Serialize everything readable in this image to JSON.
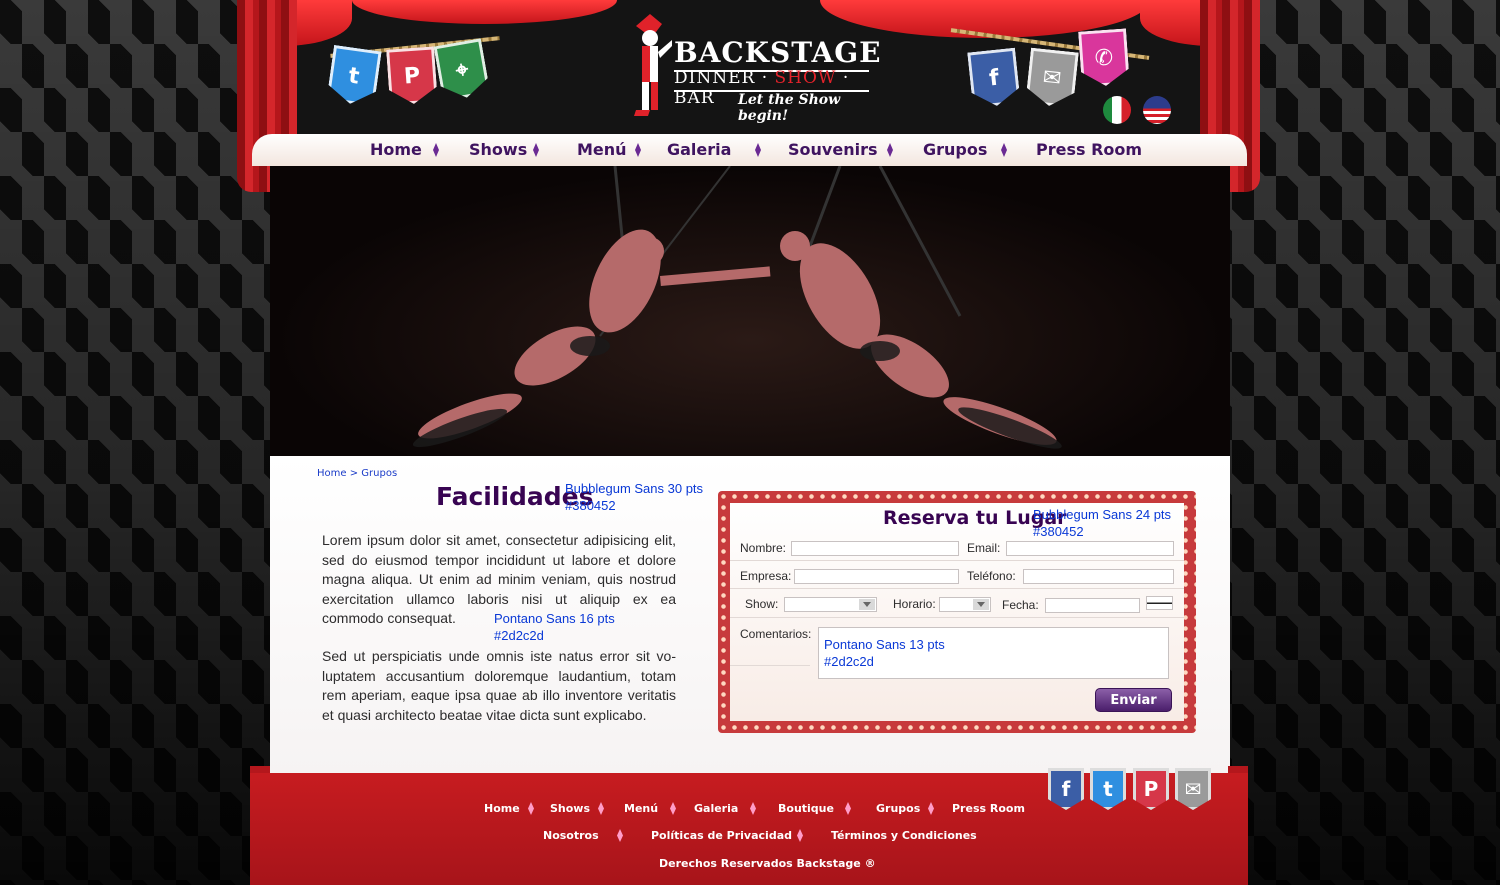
{
  "brand": {
    "title": "BACKSTAGE",
    "sub_left": "DINNER",
    "sub_mid": "SHOW",
    "sub_right": "BAR",
    "tagline": "Let the Show begin!"
  },
  "social_top_left": [
    {
      "icon": "twitter-icon",
      "glyph": "t",
      "color": "#2f8fe0"
    },
    {
      "icon": "pinterest-icon",
      "glyph": "P",
      "color": "#d63749"
    },
    {
      "icon": "location-icon",
      "glyph": "⌖",
      "color": "#2e8f4a"
    }
  ],
  "social_top_right": [
    {
      "icon": "facebook-icon",
      "glyph": "f",
      "color": "#3b5ea6"
    },
    {
      "icon": "email-icon",
      "glyph": "✉",
      "color": "#9a9a9a"
    },
    {
      "icon": "phone-icon",
      "glyph": "✆",
      "color": "#d9369c"
    }
  ],
  "nav": {
    "items": [
      "Home",
      "Shows",
      "Menú",
      "Galeria",
      "Souvenirs",
      "Grupos",
      "Press Room"
    ]
  },
  "breadcrumb": {
    "home": "Home",
    "sep": " > ",
    "current": "Grupos"
  },
  "main": {
    "heading": "Facilidades",
    "heading_note_1": "Bubblegum Sans 30 pts",
    "heading_note_2": "#380452",
    "paragraph_1": "Lorem ipsum dolor sit amet, consectetur adipisicing elit, sed do eiusmod tempor incididunt ut labore et dolore magna aliqua. Ut enim ad minim veniam, quis nostrud exercitation ullamco laboris nisi ut aliquip ex ea commodo consequat.",
    "para_note_1": "Pontano Sans 16 pts",
    "para_note_2": "#2d2c2d",
    "paragraph_2": "Sed ut perspiciatis unde omnis iste natus error sit vo-luptatem accusantium doloremque laudantium, totam rem aperiam, eaque ipsa quae ab illo inventore veritatis et quasi architecto beatae vitae dicta sunt explicabo."
  },
  "form": {
    "heading": "Reserva tu Lugar",
    "heading_note_1": "Bubblegum Sans 24 pts",
    "heading_note_2": "#380452",
    "labels": {
      "nombre": "Nombre:",
      "email": "Email:",
      "empresa": "Empresa:",
      "telefono": "Teléfono:",
      "show": "Show:",
      "horario": "Horario:",
      "fecha": "Fecha:",
      "comentarios": "Comentarios:"
    },
    "comment_note_1": "Pontano Sans 13 pts",
    "comment_note_2": "#2d2c2d",
    "submit": "Enviar"
  },
  "footer": {
    "row1": [
      "Home",
      "Shows",
      "Menú",
      "Galeria",
      "Boutique",
      "Grupos",
      "Press Room"
    ],
    "row2": [
      "Nosotros",
      "Políticas de Privacidad",
      "Términos y Condiciones"
    ],
    "copyright": "Derechos Reservados Backstage ®"
  },
  "footer_social": [
    {
      "icon": "facebook-icon",
      "glyph": "f",
      "color": "#3b5ea6"
    },
    {
      "icon": "twitter-icon",
      "glyph": "t",
      "color": "#2f8fe0"
    },
    {
      "icon": "pinterest-icon",
      "glyph": "P",
      "color": "#d63749"
    },
    {
      "icon": "email-icon",
      "glyph": "✉",
      "color": "#9a9a9a"
    }
  ]
}
